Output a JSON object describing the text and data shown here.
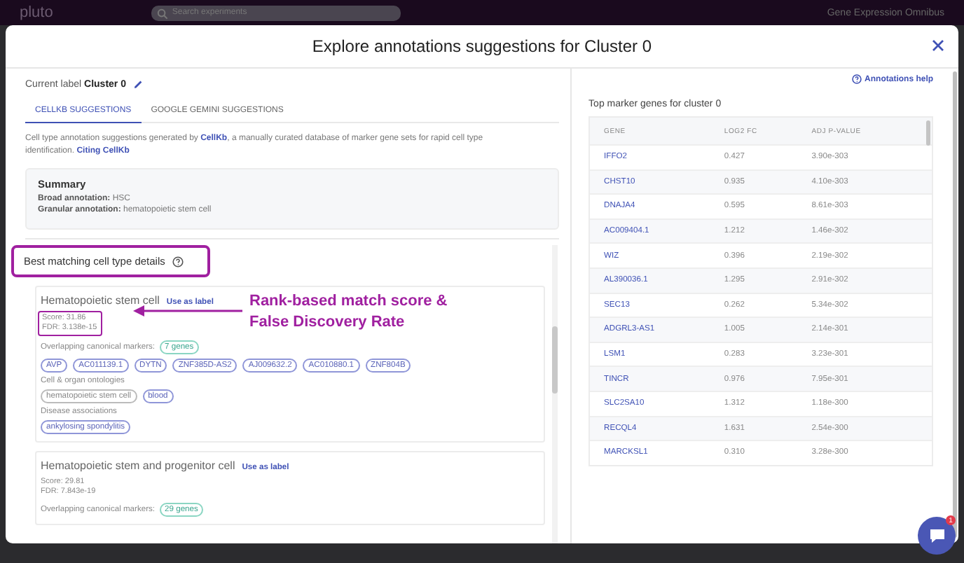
{
  "top_bar": {
    "logo": "pluto",
    "search": {
      "placeholder": "Search experiments"
    },
    "user": "Gene Expression Omnibus"
  },
  "dialog": {
    "title": "Explore annotations suggestions for Cluster 0",
    "current_label": {
      "label": "Current label",
      "value": "Cluster 0"
    },
    "tabs": [
      {
        "label": "CELLKB SUGGESTIONS",
        "selected": true
      },
      {
        "label": "GOOGLE GEMINI SUGGESTIONS",
        "selected": false
      }
    ],
    "description": {
      "before": "Cell type annotation suggestions generated by ",
      "link": "CellKb",
      "after": ", a manually curated database of marker gene sets for rapid cell type identification.",
      "citation": "Citing CellKb"
    },
    "summary": {
      "title": "Summary",
      "lines": [
        {
          "label": "Broad annotation:",
          "value": "HSC"
        },
        {
          "label": "Granular annotation:",
          "value": "hematopoietic stem cell"
        }
      ]
    },
    "details_heading": "Best matching cell type details",
    "cell_types": [
      {
        "name": "Hematopoietic stem cell",
        "action": "Use as label",
        "score": "Score: 31.86",
        "fdr": "FDR: 3.138e-15",
        "markers_label": "Overlapping canonical markers:",
        "markers_count": "7 genes",
        "markers": [
          "AVP",
          "AC011139.1",
          "DYTN",
          "ZNF385D-AS2",
          "AJ009632.2",
          "AC010880.1",
          "ZNF804B"
        ],
        "ontologies_label": "Cell & organ ontologies",
        "ontologies": [
          {
            "text": "hematopoietic stem cell",
            "kind": "cell"
          },
          {
            "text": "blood",
            "kind": "organ"
          }
        ],
        "diseases_label": "Disease associations",
        "diseases": [
          "ankylosing spondylitis"
        ]
      },
      {
        "name": "Hematopoietic stem and progenitor cell",
        "action": "Use as label",
        "score": "Score: 29.81",
        "fdr": "FDR: 7.843e-19",
        "markers_label": "Overlapping canonical markers:",
        "markers_count": "29 genes"
      }
    ],
    "callout": {
      "lines": [
        "Rank-based match score &",
        "False Discovery Rate"
      ]
    },
    "help": "Annotations help",
    "genes_title": "Top marker genes for cluster 0",
    "table": {
      "columns": [
        "GENE",
        "LOG2 FC",
        "ADJ P-VALUE"
      ],
      "rows": [
        [
          "IFFO2",
          "0.427",
          "3.90e-303"
        ],
        [
          "CHST10",
          "0.935",
          "4.10e-303"
        ],
        [
          "DNAJA4",
          "0.595",
          "8.61e-303"
        ],
        [
          "AC009404.1",
          "1.212",
          "1.46e-302"
        ],
        [
          "WIZ",
          "0.396",
          "2.19e-302"
        ],
        [
          "AL390036.1",
          "1.295",
          "2.91e-302"
        ],
        [
          "SEC13",
          "0.262",
          "5.34e-302"
        ],
        [
          "ADGRL3-AS1",
          "1.005",
          "2.14e-301"
        ],
        [
          "LSM1",
          "0.283",
          "3.23e-301"
        ],
        [
          "TINCR",
          "0.976",
          "7.95e-301"
        ],
        [
          "SLC2SA10",
          "1.312",
          "1.18e-300"
        ],
        [
          "RECQL4",
          "1.631",
          "2.54e-300"
        ],
        [
          "MARCKSL1",
          "0.310",
          "3.28e-300"
        ]
      ]
    }
  },
  "chat": {
    "badge": "1"
  }
}
